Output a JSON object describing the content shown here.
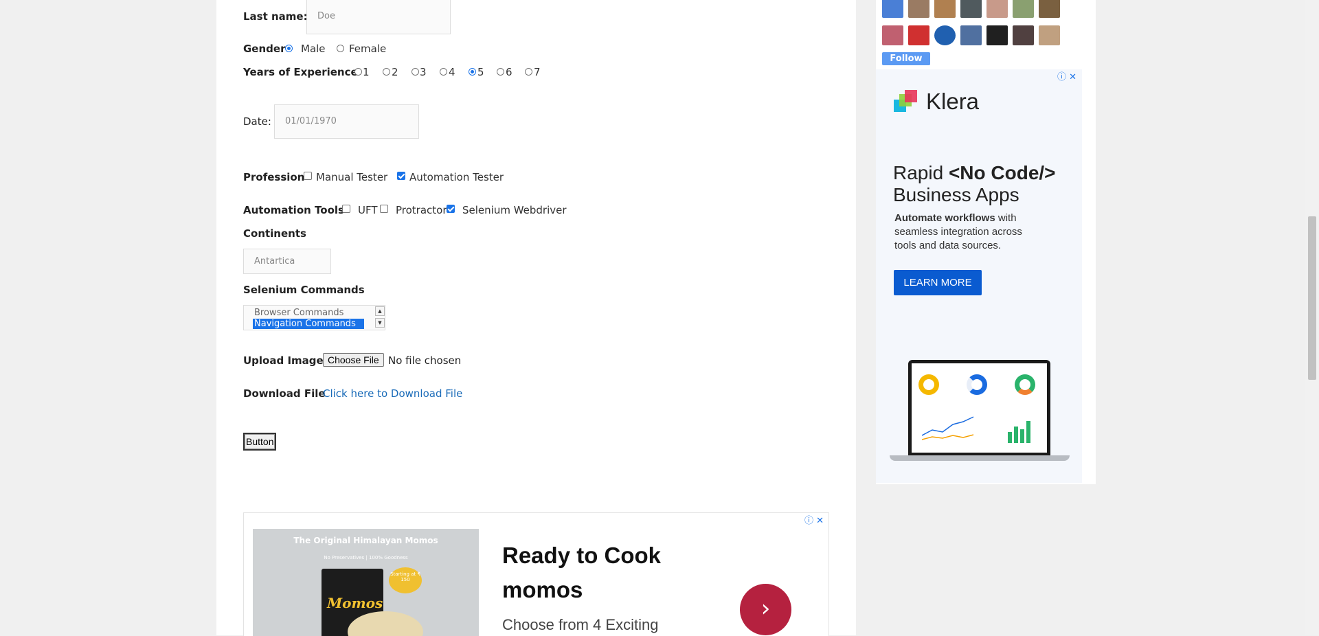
{
  "form": {
    "last_name_label": "Last name:",
    "last_name_placeholder": "Doe",
    "gender_label": "Gender",
    "gender_options": [
      "Male",
      "Female"
    ],
    "gender_selected": "Male",
    "experience_label": "Years of Experience",
    "experience_options": [
      "1",
      "2",
      "3",
      "4",
      "5",
      "6",
      "7"
    ],
    "experience_selected": "5",
    "date_label": "Date:",
    "date_placeholder": "01/01/1970",
    "profession_label": "Profession",
    "profession_options": [
      {
        "label": "Manual Tester",
        "checked": false
      },
      {
        "label": "Automation Tester",
        "checked": true
      }
    ],
    "tools_label": "Automation Tools",
    "tools_options": [
      {
        "label": "UFT",
        "checked": false
      },
      {
        "label": "Protractor",
        "checked": false
      },
      {
        "label": "Selenium Webdriver",
        "checked": true
      }
    ],
    "continents_label": "Continents",
    "continents_value": "Antartica",
    "commands_label": "Selenium Commands",
    "commands_options": [
      {
        "label": "Browser Commands",
        "selected": false
      },
      {
        "label": "Navigation Commands",
        "selected": true
      }
    ],
    "upload_label": "Upload Image",
    "choose_file_label": "Choose File",
    "no_file_text": "No file chosen",
    "download_label": "Download File",
    "download_link_text": "Click here to Download File",
    "button_label": "Button"
  },
  "sidebar": {
    "follow_label": "Follow",
    "avatar_colors": [
      "#4a7fd6",
      "#9a7b63",
      "#b08050",
      "#505a5e",
      "#c89a8a",
      "#8aa070",
      "#7a6040",
      "#c06070",
      "#d03030",
      "#2060b0",
      "#5070a0",
      "#202020",
      "#504040",
      "#c0a080"
    ]
  },
  "ads": {
    "side_ad": {
      "brand": "Klera",
      "headline_prefix": "Rapid ",
      "headline_code": "<No Code/>",
      "headline_suffix": "Business Apps",
      "body_bold": "Automate workflows",
      "body_rest": " with seamless integration across tools and data sources.",
      "cta": "LEARN MORE",
      "colors": {
        "cta": "#0a5bd0",
        "background": "#f4f7fc"
      }
    },
    "bottom_ad": {
      "image_title": "The Original Himalayan Momos",
      "image_subtitle": "No Preservatives | 100% Goodness",
      "image_price_tag": "Starting at ₹ 150",
      "image_brand": "Momos",
      "headline": "Ready to Cook momos",
      "subtext": "Choose from 4 Exciting",
      "colors": {
        "arrow_button": "#b5213f"
      }
    }
  }
}
